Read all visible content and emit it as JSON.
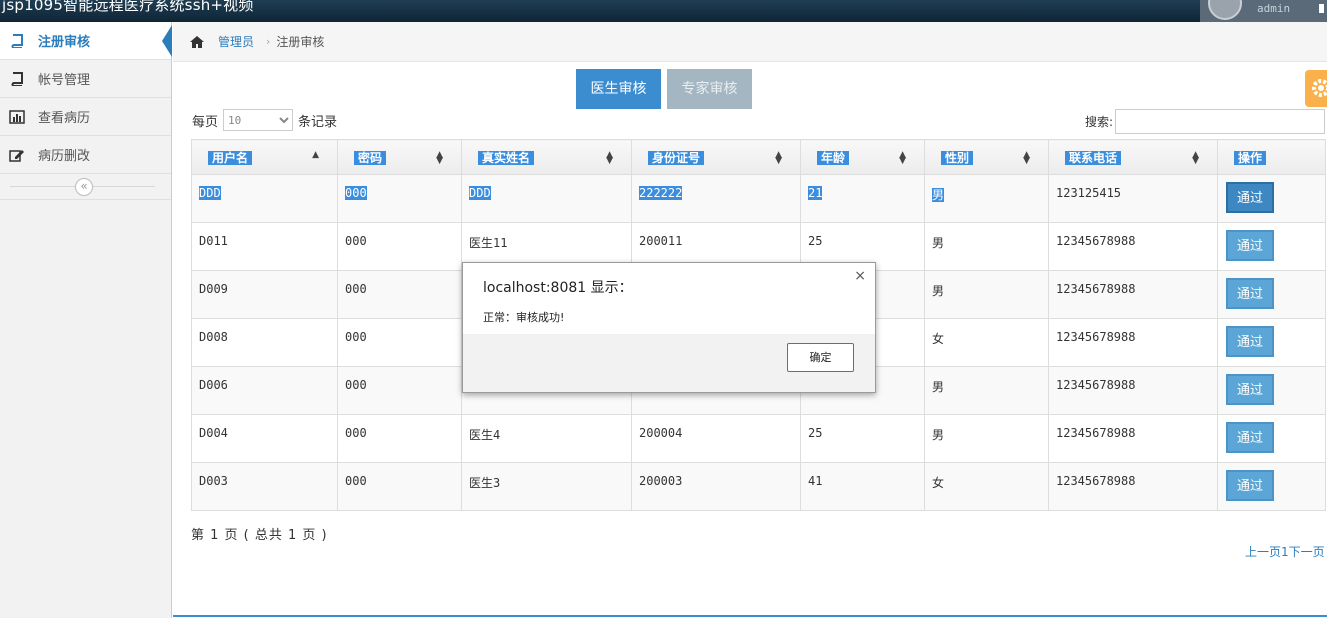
{
  "window": {
    "title": "jsp1095智能远程医疗系统ssh+视频",
    "username": "admin"
  },
  "sidebar": {
    "items": [
      {
        "label": "注册审核",
        "icon": "book-icon"
      },
      {
        "label": "帐号管理",
        "icon": "book-icon"
      },
      {
        "label": "查看病历",
        "icon": "bar-chart-icon"
      },
      {
        "label": "病历删改",
        "icon": "edit-icon"
      }
    ],
    "collapse_symbol": "«"
  },
  "breadcrumb": {
    "home_label": "管理员",
    "separator": "›",
    "current": "注册审核"
  },
  "tabs": {
    "doctor": "医生审核",
    "expert": "专家审核"
  },
  "table_controls": {
    "per_page_prefix": "每页",
    "per_page_value": "10",
    "per_page_suffix": "条记录",
    "search_label": "搜索:"
  },
  "table": {
    "headers": [
      "用户名",
      "密码",
      "真实姓名",
      "身份证号",
      "年龄",
      "性别",
      "联系电话",
      "操作"
    ],
    "rows": [
      [
        "DDD",
        "000",
        "DDD",
        "222222",
        "21",
        "男",
        "123125415",
        "通过"
      ],
      [
        "D011",
        "000",
        "医生11",
        "200011",
        "25",
        "男",
        "12345678988",
        "通过"
      ],
      [
        "D009",
        "000",
        "",
        "",
        "",
        "男",
        "12345678988",
        "通过"
      ],
      [
        "D008",
        "000",
        "",
        "",
        "",
        "女",
        "12345678988",
        "通过"
      ],
      [
        "D006",
        "000",
        "",
        "",
        "",
        "男",
        "12345678988",
        "通过"
      ],
      [
        "D004",
        "000",
        "医生4",
        "200004",
        "25",
        "男",
        "12345678988",
        "通过"
      ],
      [
        "D003",
        "000",
        "医生3",
        "200003",
        "41",
        "女",
        "12345678988",
        "通过"
      ]
    ]
  },
  "pagination": {
    "info": "第 1 页 ( 总共 1 页 )",
    "nav": "上一页1下一页"
  },
  "dialog": {
    "title": "localhost:8081 显示：",
    "message": "正常：审核成功!",
    "ok_label": "确定",
    "close_symbol": "×"
  },
  "colors": {
    "accent": "#3b8dd0",
    "selection": "#3b8ede",
    "expert_tab": "#a4b6c1",
    "settings_tab": "#fbb14b"
  }
}
